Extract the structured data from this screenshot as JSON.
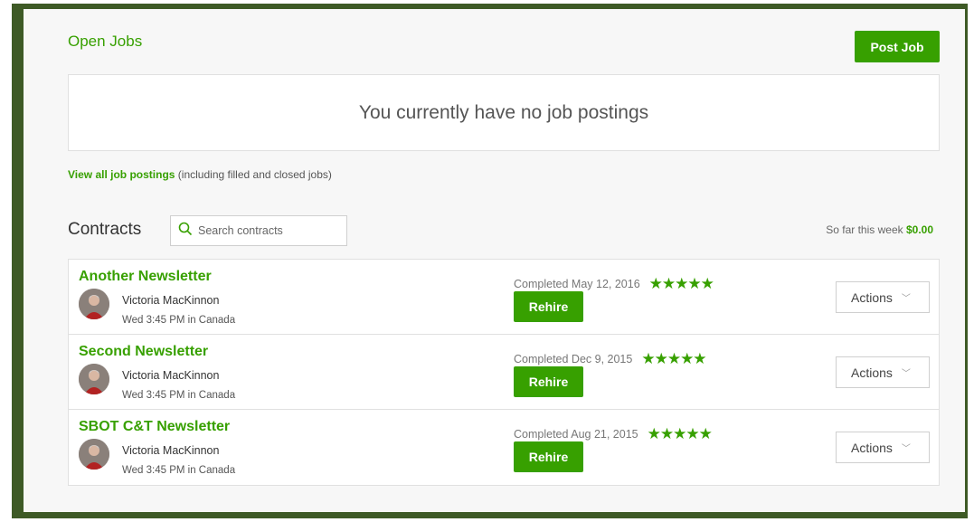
{
  "colors": {
    "accent": "#37a000",
    "frame": "#3e5a26"
  },
  "open_jobs": {
    "title": "Open Jobs",
    "post_job_label": "Post Job",
    "empty_message": "You currently have no job postings",
    "view_all_link": "View all job postings",
    "view_all_note": " (including filled and closed jobs)"
  },
  "contracts": {
    "title": "Contracts",
    "search_placeholder": "Search contracts",
    "week_label": "So far this week ",
    "week_amount": "$0.00",
    "items": [
      {
        "title": "Another Newsletter",
        "freelancer": "Victoria MacKinnon",
        "local_time": "Wed 3:45 PM in Canada",
        "completed": "Completed May 12, 2016",
        "stars": "★★★★★",
        "rating": 5,
        "rehire_label": "Rehire",
        "actions_label": "Actions"
      },
      {
        "title": "Second Newsletter",
        "freelancer": "Victoria MacKinnon",
        "local_time": "Wed 3:45 PM in Canada",
        "completed": "Completed Dec 9, 2015",
        "stars": "★★★★★",
        "rating": 5,
        "rehire_label": "Rehire",
        "actions_label": "Actions"
      },
      {
        "title": "SBOT C&T Newsletter",
        "freelancer": "Victoria MacKinnon",
        "local_time": "Wed 3:45 PM in Canada",
        "completed": "Completed Aug 21, 2015",
        "stars": "★★★★★",
        "rating": 5,
        "rehire_label": "Rehire",
        "actions_label": "Actions"
      }
    ]
  }
}
